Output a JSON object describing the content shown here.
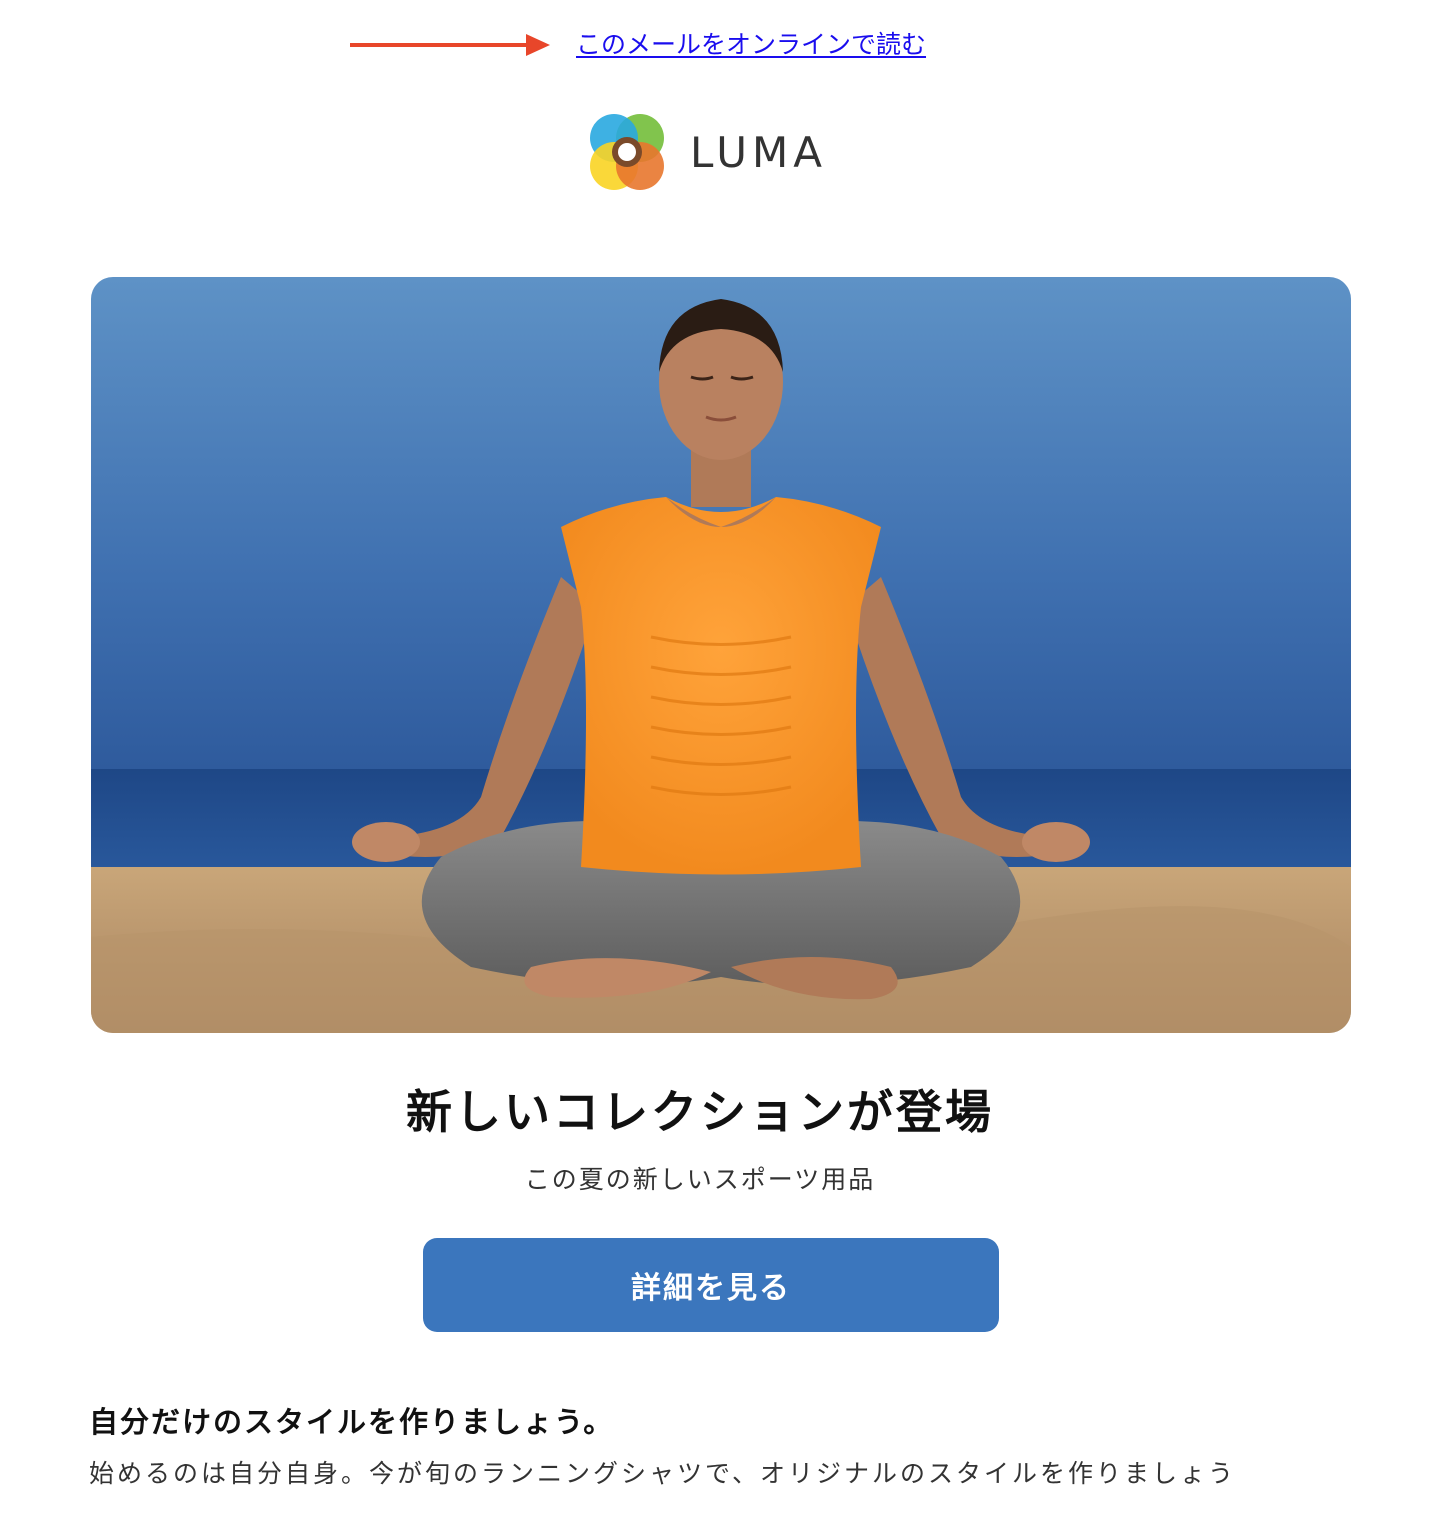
{
  "header": {
    "online_link": "このメールをオンラインで読む",
    "arrow_color": "#e8462a"
  },
  "logo": {
    "text": "LUMA",
    "colors": [
      "#7ac143",
      "#29a9e0",
      "#f9d423",
      "#e8772e"
    ]
  },
  "hero": {
    "image_description_icon": "yoga-beach-photo"
  },
  "main": {
    "headline": "新しいコレクションが登場",
    "subheadline": "この夏の新しいスポーツ用品",
    "cta_label": "詳細を見る",
    "cta_color": "#3b76bd"
  },
  "section": {
    "title": "自分だけのスタイルを作りましょう。",
    "body": "始めるのは自分自身。今が旬のランニングシャツで、オリジナルのスタイルを作りましょう"
  }
}
